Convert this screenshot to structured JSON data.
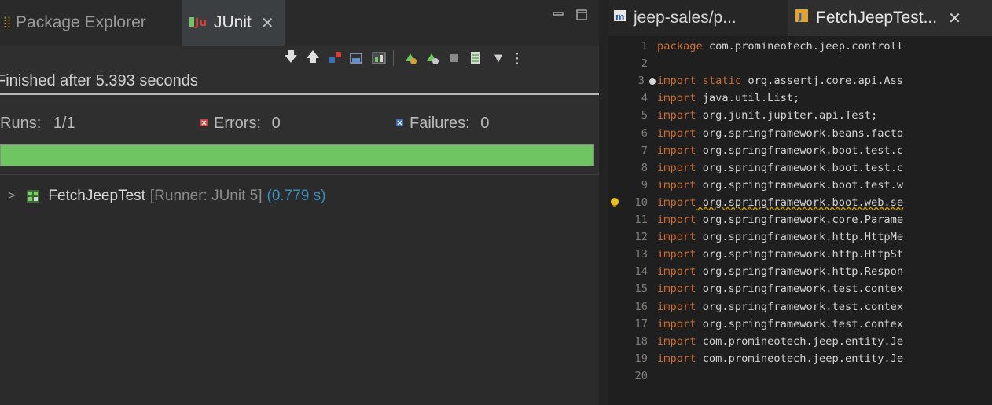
{
  "left_panel": {
    "tabs": [
      {
        "label": "Package Explorer",
        "icon": "package-explorer-icon"
      },
      {
        "label": "JUnit",
        "icon": "junit-icon",
        "active": true
      }
    ],
    "close_glyph": "✕",
    "status": "Finished after 5.393 seconds",
    "runs_label": "Runs:",
    "runs_value": "1/1",
    "errors_label": "Errors:",
    "errors_value": "0",
    "failures_label": "Failures:",
    "failures_value": "0",
    "progress": 1.0,
    "progress_color": "#6fc562",
    "tree": {
      "name": "FetchJeepTest",
      "runner": "[Runner: JUnit 5]",
      "time": "(0.779 s)"
    }
  },
  "editor": {
    "tabs": [
      {
        "label": "jeep-sales/p...",
        "icon": "maven-pom-icon"
      },
      {
        "label": "FetchJeepTest...",
        "icon": "java-test-icon",
        "active": true
      }
    ],
    "lines": [
      {
        "n": "1",
        "kw": "package",
        "rest": " com.promineotech.jeep.controll"
      },
      {
        "n": "2",
        "kw": "",
        "rest": ""
      },
      {
        "n": "3",
        "kw": "import static",
        "rest": " org.assertj.core.api.Ass"
      },
      {
        "n": "4",
        "kw": "import",
        "rest": " java.util.List;"
      },
      {
        "n": "5",
        "kw": "import",
        "rest": " org.junit.jupiter.api.Test;"
      },
      {
        "n": "6",
        "kw": "import",
        "rest": " org.springframework.beans.facto"
      },
      {
        "n": "7",
        "kw": "import",
        "rest": " org.springframework.boot.test.c"
      },
      {
        "n": "8",
        "kw": "import",
        "rest": " org.springframework.boot.test.c"
      },
      {
        "n": "9",
        "kw": "import",
        "rest": " org.springframework.boot.test.w"
      },
      {
        "n": "10",
        "kw": "import",
        "rest": " org.springframework.boot.web.se"
      },
      {
        "n": "11",
        "kw": "import",
        "rest": " org.springframework.core.Parame"
      },
      {
        "n": "12",
        "kw": "import",
        "rest": " org.springframework.http.HttpMe"
      },
      {
        "n": "13",
        "kw": "import",
        "rest": " org.springframework.http.HttpSt"
      },
      {
        "n": "14",
        "kw": "import",
        "rest": " org.springframework.http.Respon"
      },
      {
        "n": "15",
        "kw": "import",
        "rest": " org.springframework.test.contex"
      },
      {
        "n": "16",
        "kw": "import",
        "rest": " org.springframework.test.contex"
      },
      {
        "n": "17",
        "kw": "import",
        "rest": " org.springframework.test.contex"
      },
      {
        "n": "18",
        "kw": "import",
        "rest": " com.promineotech.jeep.entity.Je"
      },
      {
        "n": "19",
        "kw": "import",
        "rest": " com.promineotech.jeep.entity.Je"
      },
      {
        "n": "20",
        "kw": "",
        "rest": ""
      }
    ]
  }
}
